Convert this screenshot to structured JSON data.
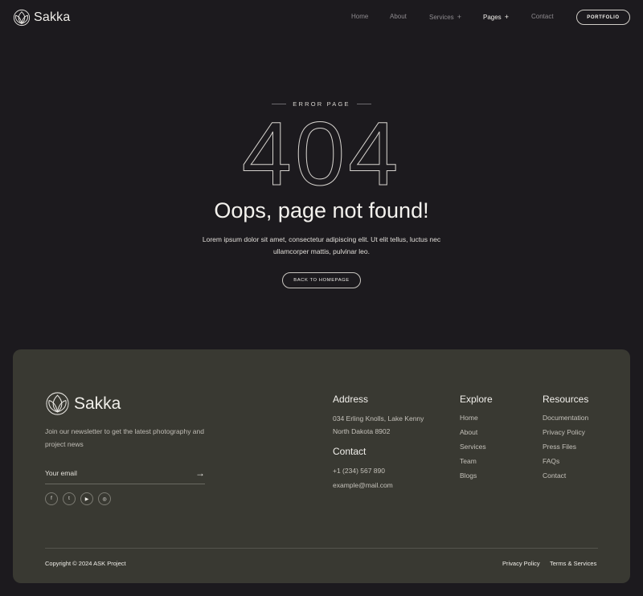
{
  "header": {
    "brand": "Sakka",
    "nav": {
      "home": "Home",
      "about": "About",
      "services": "Services",
      "pages": "Pages",
      "contact": "Contact"
    },
    "plus": "+",
    "portfolio": "PORTFOLIO"
  },
  "hero": {
    "tag": "ERROR PAGE",
    "code": "404",
    "title": "Oops, page not found!",
    "description": "Lorem ipsum dolor sit amet, consectetur adipiscing elit. Ut elit tellus, luctus nec ullamcorper mattis, pulvinar leo.",
    "button": "BACK TO HOMEPAGE"
  },
  "footer": {
    "brand": "Sakka",
    "newsletter": "Join our newsletter to get the latest photography and project news",
    "email_placeholder": "Your email",
    "arrow": "→",
    "socials": [
      "f",
      "t",
      "▶",
      "◎"
    ],
    "address": {
      "title": "Address",
      "line1": "034 Erling Knolls, Lake Kenny",
      "line2": "North Dakota 8902"
    },
    "contact": {
      "title": "Contact",
      "phone": "+1 (234) 567 890",
      "email": "example@mail.com"
    },
    "explore": {
      "title": "Explore",
      "items": [
        "Home",
        "About",
        "Services",
        "Team",
        "Blogs"
      ]
    },
    "resources": {
      "title": "Resources",
      "items": [
        "Documentation",
        "Privacy Policy",
        "Press Files",
        "FAQs",
        "Contact"
      ]
    },
    "copyright": "Copyright © 2024 ASK Project",
    "privacy": "Privacy Policy",
    "terms": "Terms & Services"
  },
  "colors": {
    "background": "#1c1a1e",
    "footer": "#393932",
    "text": "#e9e7e3"
  }
}
